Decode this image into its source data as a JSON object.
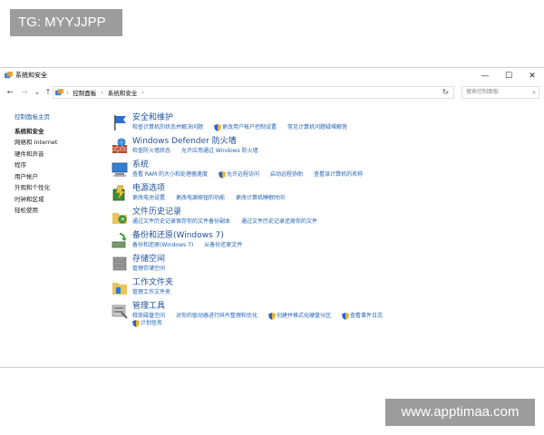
{
  "watermark_top": "TG: MYYJJPP",
  "watermark_bottom": "www.apptimaa.com",
  "window": {
    "title": "系统和安全",
    "controls": [
      "—",
      "☐",
      "✕"
    ]
  },
  "address": {
    "crumbs": [
      "控制面板",
      "系统和安全"
    ],
    "search_placeholder": "搜索控制面板"
  },
  "sidebar": {
    "home": "控制面板主页",
    "items": [
      {
        "label": "系统和安全",
        "active": true
      },
      {
        "label": "网络和 Internet"
      },
      {
        "label": "硬件和声音"
      },
      {
        "label": "程序"
      },
      {
        "label": "用户帐户"
      },
      {
        "label": "外观和个性化"
      },
      {
        "label": "时钟和区域"
      },
      {
        "label": "轻松使用"
      }
    ]
  },
  "categories": [
    {
      "title": "安全和维护",
      "links": [
        "检查计算机的状态并解决问题",
        "更改用户帐户控制设置",
        "常见计算机问题疑难解答"
      ]
    },
    {
      "title": "Windows Defender 防火墙",
      "links": [
        "检查防火墙状态",
        "允许应用通过 Windows 防火墙"
      ]
    },
    {
      "title": "系统",
      "links": [
        "查看 RAM 的大小和处理器速度",
        "允许远程访问",
        "启动远程协助",
        "查看该计算机的名称"
      ]
    },
    {
      "title": "电源选项",
      "links": [
        "更改电池设置",
        "更改电源按钮的功能",
        "更改计算机睡眠时间"
      ]
    },
    {
      "title": "文件历史记录",
      "links": [
        "通过文件历史记录保存你的文件备份副本",
        "通过文件历史记录还原你的文件"
      ]
    },
    {
      "title": "备份和还原(Windows 7)",
      "links": [
        "备份和还原(Windows 7)",
        "从备份还原文件"
      ]
    },
    {
      "title": "存储空间",
      "links": [
        "管理存储空间"
      ]
    },
    {
      "title": "工作文件夹",
      "links": [
        "管理工作文件夹"
      ]
    },
    {
      "title": "管理工具",
      "links": [
        "释放磁盘空间",
        "对你的驱动器进行碎片整理和优化",
        "创建并格式化硬盘分区",
        "查看事件日志",
        "计划任务"
      ]
    }
  ]
}
